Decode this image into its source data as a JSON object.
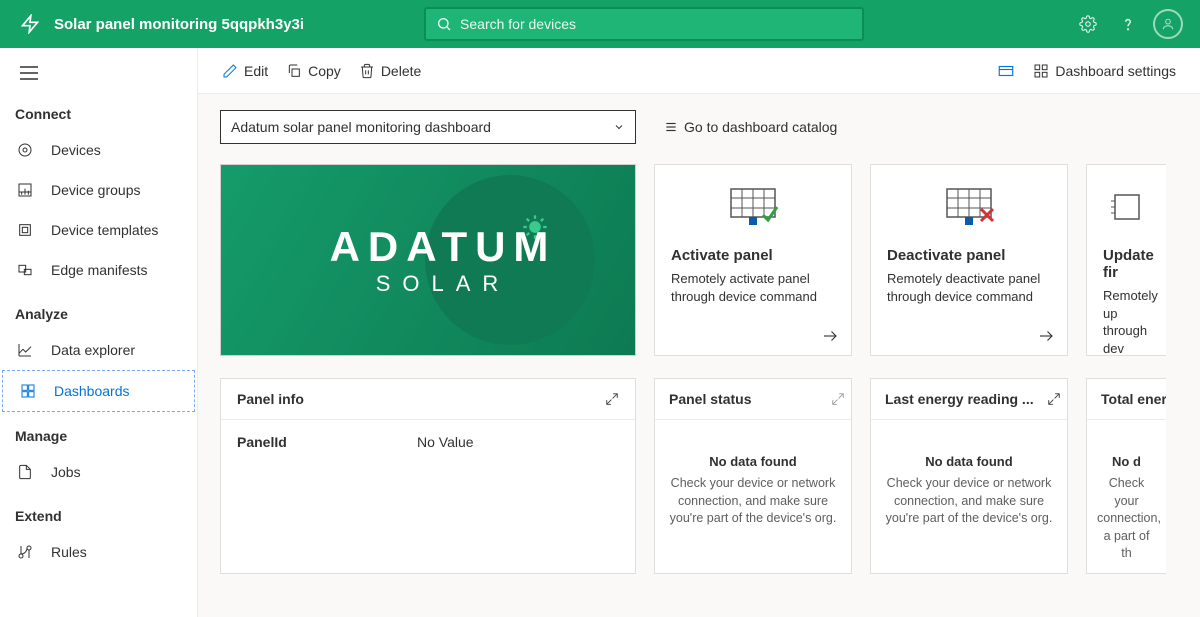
{
  "header": {
    "title": "Solar panel monitoring 5qqpkh3y3i",
    "search_placeholder": "Search for devices"
  },
  "sidebar": {
    "sections": {
      "s0": {
        "title": "Connect",
        "items": [
          {
            "label": "Devices"
          },
          {
            "label": "Device groups"
          },
          {
            "label": "Device templates"
          },
          {
            "label": "Edge manifests"
          }
        ]
      },
      "s1": {
        "title": "Analyze",
        "items": [
          {
            "label": "Data explorer"
          },
          {
            "label": "Dashboards"
          }
        ]
      },
      "s2": {
        "title": "Manage",
        "items": [
          {
            "label": "Jobs"
          }
        ]
      },
      "s3": {
        "title": "Extend",
        "items": [
          {
            "label": "Rules"
          }
        ]
      }
    }
  },
  "toolbar": {
    "edit": "Edit",
    "copy": "Copy",
    "delete": "Delete",
    "settings": "Dashboard settings"
  },
  "dashboard": {
    "selector": "Adatum solar panel monitoring dashboard",
    "catalog_link": "Go to dashboard catalog"
  },
  "brand": {
    "line1": "ADATUM",
    "line2": "SOLAR"
  },
  "cmd_tiles": {
    "activate": {
      "title": "Activate panel",
      "desc": "Remotely activate panel through device command"
    },
    "deactivate": {
      "title": "Deactivate panel",
      "desc": "Remotely deactivate panel through device command"
    },
    "update": {
      "title": "Update fir",
      "desc": "Remotely up through dev"
    }
  },
  "info_tile": {
    "title": "Panel info",
    "key": "PanelId",
    "value": "No Value"
  },
  "status_tiles": {
    "panel_status": {
      "title": "Panel status"
    },
    "last_energy": {
      "title": "Last energy reading ..."
    },
    "total_energy": {
      "title": "Total ener"
    }
  },
  "nodata": {
    "title": "No data found",
    "body": "Check your device or network connection, and make sure you're part of the device's org.",
    "title_short": "No d",
    "body_short": "Check your connection, a part of th"
  }
}
